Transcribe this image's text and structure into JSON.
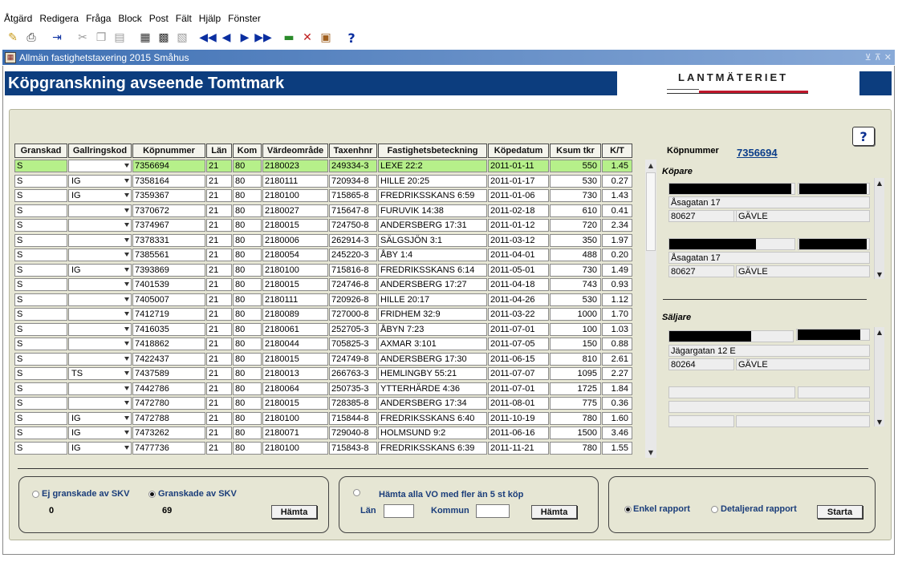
{
  "menu": [
    "Åtgärd",
    "Redigera",
    "Fråga",
    "Block",
    "Post",
    "Fält",
    "Hjälp",
    "Fönster"
  ],
  "window": {
    "title": "Allmän fastighetstaxering  2015 Småhus"
  },
  "heading": "Köpgranskning avseende Tomtmark",
  "logo": "LANTMÄTERIET",
  "help_label": "?",
  "table": {
    "columns": [
      "Granskad",
      "Gallringskod",
      "Köpnummer",
      "Län",
      "Kom",
      "Värdeområde",
      "Taxenhnr",
      "Fastighetsbeteckning",
      "Köpedatum",
      "Ksum tkr",
      "K/T"
    ],
    "rows": [
      [
        "S",
        "",
        "7356694",
        "21",
        "80",
        "2180023",
        "249334-3",
        "LEXE 22:2",
        "2011-01-11",
        "550",
        "1.45"
      ],
      [
        "S",
        "IG",
        "7358164",
        "21",
        "80",
        "2180111",
        "720934-8",
        "HILLE 20:25",
        "2011-01-17",
        "530",
        "0.27"
      ],
      [
        "S",
        "IG",
        "7359367",
        "21",
        "80",
        "2180100",
        "715865-8",
        "FREDRIKSSKANS 6:59",
        "2011-01-06",
        "730",
        "1.43"
      ],
      [
        "S",
        "",
        "7370672",
        "21",
        "80",
        "2180027",
        "715647-8",
        "FURUVIK 14:38",
        "2011-02-18",
        "610",
        "0.41"
      ],
      [
        "S",
        "",
        "7374967",
        "21",
        "80",
        "2180015",
        "724750-8",
        "ANDERSBERG 17:31",
        "2011-01-12",
        "720",
        "2.34"
      ],
      [
        "S",
        "",
        "7378331",
        "21",
        "80",
        "2180006",
        "262914-3",
        "SÄLGSJÖN 3:1",
        "2011-03-12",
        "350",
        "1.97"
      ],
      [
        "S",
        "",
        "7385561",
        "21",
        "80",
        "2180054",
        "245220-3",
        "ÅBY 1:4",
        "2011-04-01",
        "488",
        "0.20"
      ],
      [
        "S",
        "IG",
        "7393869",
        "21",
        "80",
        "2180100",
        "715816-8",
        "FREDRIKSSKANS 6:14",
        "2011-05-01",
        "730",
        "1.49"
      ],
      [
        "S",
        "",
        "7401539",
        "21",
        "80",
        "2180015",
        "724746-8",
        "ANDERSBERG 17:27",
        "2011-04-18",
        "743",
        "0.93"
      ],
      [
        "S",
        "",
        "7405007",
        "21",
        "80",
        "2180111",
        "720926-8",
        "HILLE 20:17",
        "2011-04-26",
        "530",
        "1.12"
      ],
      [
        "S",
        "",
        "7412719",
        "21",
        "80",
        "2180089",
        "727000-8",
        "FRIDHEM 32:9",
        "2011-03-22",
        "1000",
        "1.70"
      ],
      [
        "S",
        "",
        "7416035",
        "21",
        "80",
        "2180061",
        "252705-3",
        "ÅBYN 7:23",
        "2011-07-01",
        "100",
        "1.03"
      ],
      [
        "S",
        "",
        "7418862",
        "21",
        "80",
        "2180044",
        "705825-3",
        "AXMAR 3:101",
        "2011-07-05",
        "150",
        "0.88"
      ],
      [
        "S",
        "",
        "7422437",
        "21",
        "80",
        "2180015",
        "724749-8",
        "ANDERSBERG 17:30",
        "2011-06-15",
        "810",
        "2.61"
      ],
      [
        "S",
        "TS",
        "7437589",
        "21",
        "80",
        "2180013",
        "266763-3",
        "HEMLINGBY 55:21",
        "2011-07-07",
        "1095",
        "2.27"
      ],
      [
        "S",
        "",
        "7442786",
        "21",
        "80",
        "2180064",
        "250735-3",
        "YTTERHÄRDE 4:36",
        "2011-07-01",
        "1725",
        "1.84"
      ],
      [
        "S",
        "",
        "7472780",
        "21",
        "80",
        "2180015",
        "728385-8",
        "ANDERSBERG 17:34",
        "2011-08-01",
        "775",
        "0.36"
      ],
      [
        "S",
        "IG",
        "7472788",
        "21",
        "80",
        "2180100",
        "715844-8",
        "FREDRIKSSKANS 6:40",
        "2011-10-19",
        "780",
        "1.60"
      ],
      [
        "S",
        "IG",
        "7473262",
        "21",
        "80",
        "2180071",
        "729040-8",
        "HOLMSUND 9:2",
        "2011-06-16",
        "1500",
        "3.46"
      ],
      [
        "S",
        "IG",
        "7477736",
        "21",
        "80",
        "2180100",
        "715843-8",
        "FREDRIKSSKANS 6:39",
        "2011-11-21",
        "780",
        "1.55"
      ]
    ]
  },
  "detail": {
    "kopnummer_label": "Köpnummer",
    "kopnummer_value": "7356694",
    "kopare_label": "Köpare",
    "kopare": [
      {
        "address": "Åsagatan 17",
        "postnr": "80627",
        "ort": "GÄVLE"
      },
      {
        "address": "Åsagatan 17",
        "postnr": "80627",
        "ort": "GÄVLE"
      }
    ],
    "saljare_label": "Säljare",
    "saljare": [
      {
        "address": "Jägargatan 12 E",
        "postnr": "80264",
        "ort": "GÄVLE"
      }
    ]
  },
  "filter": {
    "ej_granskade_label": "Ej granskade av SKV",
    "ej_granskade_count": "0",
    "granskade_label": "Granskade av SKV",
    "granskade_count": "69",
    "hamta_label": "Hämta"
  },
  "vo": {
    "label": "Hämta alla VO med fler än 5 st köp",
    "lan_label": "Län",
    "lan_value": "",
    "kommun_label": "Kommun",
    "kommun_value": "",
    "hamta_label": "Hämta"
  },
  "report": {
    "enkel_label": "Enkel rapport",
    "detaljerad_label": "Detaljerad rapport",
    "starta_label": "Starta"
  },
  "colors": {
    "header_band": "#0c3d7e",
    "selected_row": "#b6f08a",
    "panel": "#e6e6d4",
    "logo_red": "#c0182c"
  }
}
